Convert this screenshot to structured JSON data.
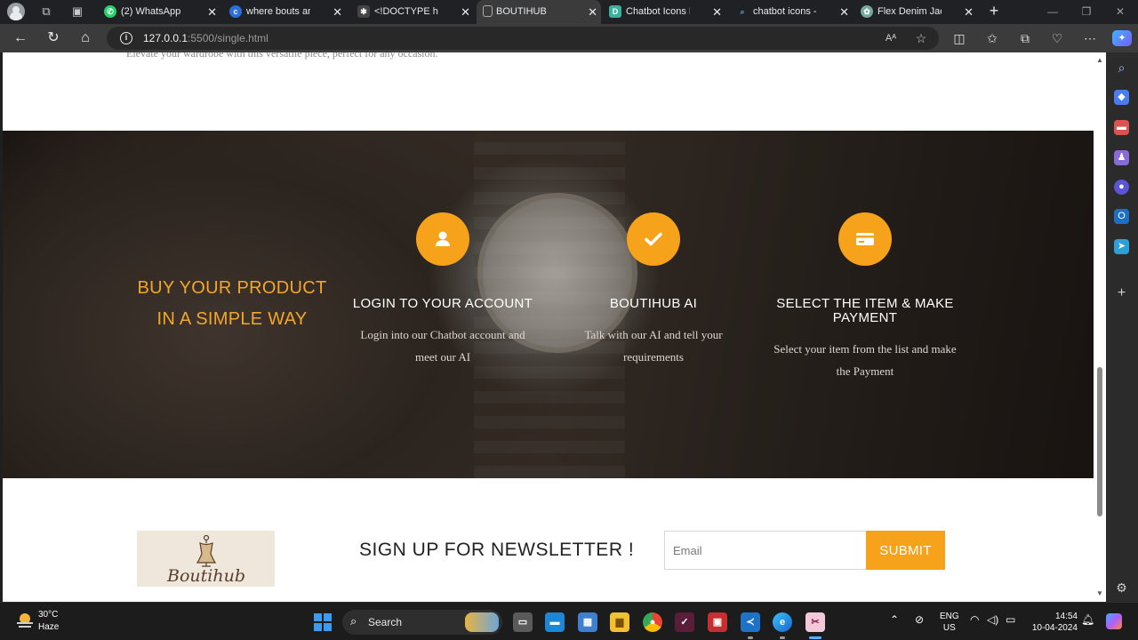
{
  "browser": {
    "tabs": [
      {
        "label": "(2) WhatsApp",
        "icon": "whatsapp-icon",
        "color": "#25d366"
      },
      {
        "label": "where bouts and bu",
        "icon": "copilot-icon",
        "color": "#2a6fdb"
      },
      {
        "label": "<!DOCTYPE html>",
        "icon": "openai-icon",
        "color": "#444444"
      },
      {
        "label": "BOUTIHUB",
        "icon": "page-icon",
        "color": "#555555"
      },
      {
        "label": "Chatbot Icons Phot",
        "icon": "site-icon",
        "color": "#3bb39c"
      },
      {
        "label": "chatbot icons - Sea",
        "icon": "search-icon",
        "color": "#2a6fdb"
      },
      {
        "label": "Flex Denim Jacket I",
        "icon": "chatgpt-icon",
        "color": "#74aa9c"
      }
    ],
    "url_host": "127.0.0.1",
    "url_rest": ":5500/single.html"
  },
  "page": {
    "prev_description": "Elevate your wardrobe with this versatile piece, perfect for any occasion.",
    "hero": {
      "title_line1": "BUY YOUR PRODUCT",
      "title_line2": "IN A SIMPLE WAY",
      "accent_color": "#f6a21a",
      "steps": [
        {
          "icon": "user-icon",
          "title": "LOGIN TO YOUR ACCOUNT",
          "desc_line1": "Login into our Chatbot account and",
          "desc_line2": "meet our AI"
        },
        {
          "icon": "checkmark-icon",
          "title": "BOUTIHUB AI",
          "desc_line1": "Talk with our AI and tell your",
          "desc_line2": "requirements"
        },
        {
          "icon": "credit-card-icon",
          "title_line1": "SELECT THE ITEM & MAKE",
          "title_line2": "PAYMENT",
          "desc_line1": "Select your item from the list and make",
          "desc_line2": "the Payment"
        }
      ]
    },
    "newsletter": {
      "logo_text": "Boutihub",
      "title": "SIGN UP FOR NEWSLETTER !",
      "email_placeholder": "Email",
      "submit_label": "SUBMIT"
    }
  },
  "taskbar": {
    "weather_temp": "30°C",
    "weather_cond": "Haze",
    "search_label": "Search",
    "lang_line1": "ENG",
    "lang_line2": "US",
    "time": "14:54",
    "date": "10-04-2024"
  }
}
